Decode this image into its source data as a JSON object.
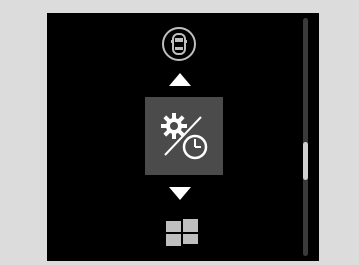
{
  "menu": {
    "items": [
      {
        "id": "vehicle-status",
        "icon": "car-top-view-icon"
      },
      {
        "id": "settings-clock",
        "icon": "gear-and-clock-icon",
        "selected": true
      },
      {
        "id": "apps",
        "icon": "tiles-icon"
      }
    ],
    "scroll_position": 0.62,
    "scroll_thumb_fraction": 0.16
  },
  "colors": {
    "screen_bg": "#000000",
    "frame_bg": "#dcdcdc",
    "selected_tile": "#4b4b4b",
    "icon": "#ffffff",
    "muted_icon": "#bfbfbf"
  }
}
